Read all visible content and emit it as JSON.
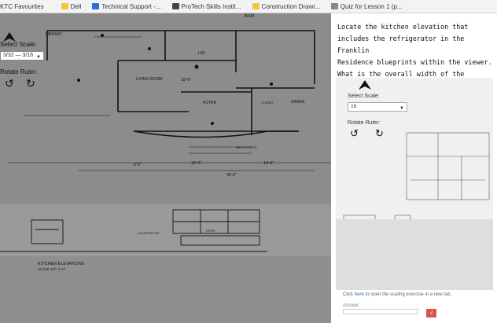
{
  "bookmarks": [
    {
      "label": "KTC Favourites",
      "icon": "folder-icon"
    },
    {
      "label": "Dell",
      "icon": "folder-icon"
    },
    {
      "label": "Technical Support -...",
      "icon": "bolt-icon"
    },
    {
      "label": "ProTech Skills Instit...",
      "icon": "protech-icon"
    },
    {
      "label": "Construction Drawi...",
      "icon": "folder-icon"
    },
    {
      "label": "Quiz for Lesson 1 (p...",
      "icon": "edu-icon"
    }
  ],
  "left_pane": {
    "scale_label": "Select Scale:",
    "scale_value": "3/32 — 3/16",
    "rotate_label": "Rotate Ruler:",
    "plan_labels": {
      "bar": "BAR",
      "library": "LIBRARY",
      "living_room": "LIVING ROOM",
      "foyer": "FOYER",
      "dining": "DINING",
      "lav": "LAV",
      "closet": "CLOSET",
      "brick_steps": "BRICK STEPS",
      "kitchen_elevations": "KITCHEN ELEVATIONS",
      "kitchen_scale": "SCALE 1/4\"=1'-0\"",
      "countertop": "COUNTERTOP",
      "open": "OPEN",
      "dim_10_6": "18'-6\"",
      "dim_14_3": "14'-3\"",
      "dim_14_3b": "14'-3\"",
      "dim_48": "48'-0\"",
      "dim_8": "8'-0\""
    }
  },
  "right_pane": {
    "question_lines": [
      "Locate the kitchen elevation that",
      "includes the refrigerator in the Franklin",
      "Residence blueprints within the viewer.",
      "What is the overall width of the cabinets?"
    ],
    "scale_label": "Select Scale:",
    "scale_value": "16",
    "rotate_label": "Rotate Ruler:",
    "link_prefix": "Click ",
    "link_text": "here",
    "link_suffix": " to open the scaling exercise in a new tab.",
    "answer_label": "Answer:",
    "sqrt_symbol": "√"
  },
  "colors": {
    "blueprint_bg": "#8a8a8a",
    "line": "#111111",
    "link": "#2a6ad0",
    "sqrt_button": "#d9534f"
  }
}
